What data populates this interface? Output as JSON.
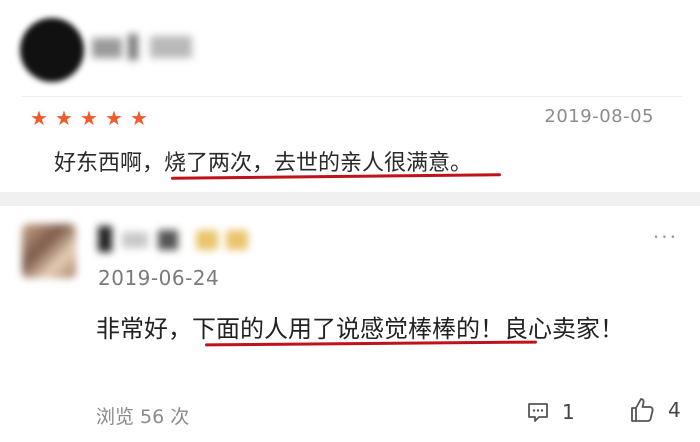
{
  "reviews": [
    {
      "rating_label": "★★★★★",
      "rating": 5,
      "date": "2019-08-05",
      "text": "好东西啊，烧了两次，去世的亲人很满意。"
    },
    {
      "date": "2019-06-24",
      "text": "非常好，下面的人用了说感觉棒棒的！良心卖家！",
      "more_label": "···",
      "views_label": "浏览 56 次",
      "comment_count": "1",
      "like_count": "4"
    }
  ],
  "colors": {
    "star": "#f15a2b",
    "underline": "#c0121a",
    "meta_text": "#8a8a8a"
  },
  "icons": [
    "comment-icon",
    "thumbs-up-icon",
    "more-icon",
    "star-icon"
  ]
}
